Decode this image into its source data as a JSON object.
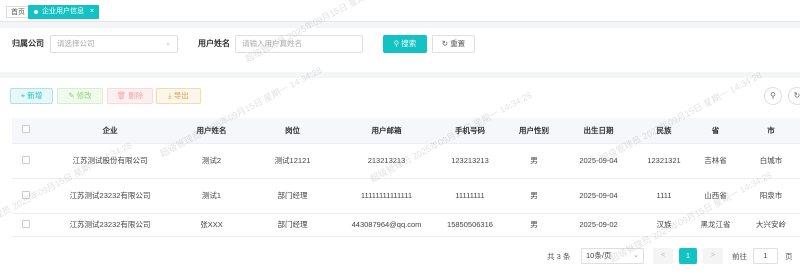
{
  "tabs": {
    "home": "首页",
    "active": "企业用户信息",
    "close": "×"
  },
  "query": {
    "company_label": "归属公司",
    "company_placeholder": "请选择公司",
    "username_label": "用户姓名",
    "username_placeholder": "请输入用户真姓名",
    "search_label": "搜索",
    "reset_label": "重置"
  },
  "toolbar": {
    "add": "新增",
    "edit": "修改",
    "delete": "删除",
    "export": "导出"
  },
  "table": {
    "headers": [
      "企业",
      "用户姓名",
      "岗位",
      "用户邮箱",
      "手机号码",
      "用户性别",
      "出生日期",
      "民族",
      "省",
      "市"
    ],
    "rows": [
      [
        "江苏测试股份有限公司",
        "测试2",
        "测试12121",
        "213213213",
        "123213213",
        "男",
        "2025-09-04",
        "12321321",
        "吉林省",
        "白城市"
      ],
      [
        "江苏测试23232有限公司",
        "测试1",
        "部门经理",
        "11111111111111",
        "11111111",
        "男",
        "2025-09-04",
        "1111",
        "山西省",
        "阳泉市"
      ],
      [
        "江苏测试23232有限公司",
        "张XXX",
        "部门经理",
        "443087964@qq.com",
        "15850506316",
        "男",
        "2025-09-02",
        "汉族",
        "黑龙江省",
        "大兴安岭"
      ]
    ]
  },
  "pagination": {
    "total": "共 3 条",
    "page_size": "10条/页",
    "current": "1",
    "goto_label": "前往",
    "goto_value": "1",
    "page_suffix": "页"
  },
  "watermark": "超级管理员 2025年09月15日 星期一 14:34:28",
  "colors": {
    "accent": "#13c2c2",
    "link": "#1890ff"
  }
}
